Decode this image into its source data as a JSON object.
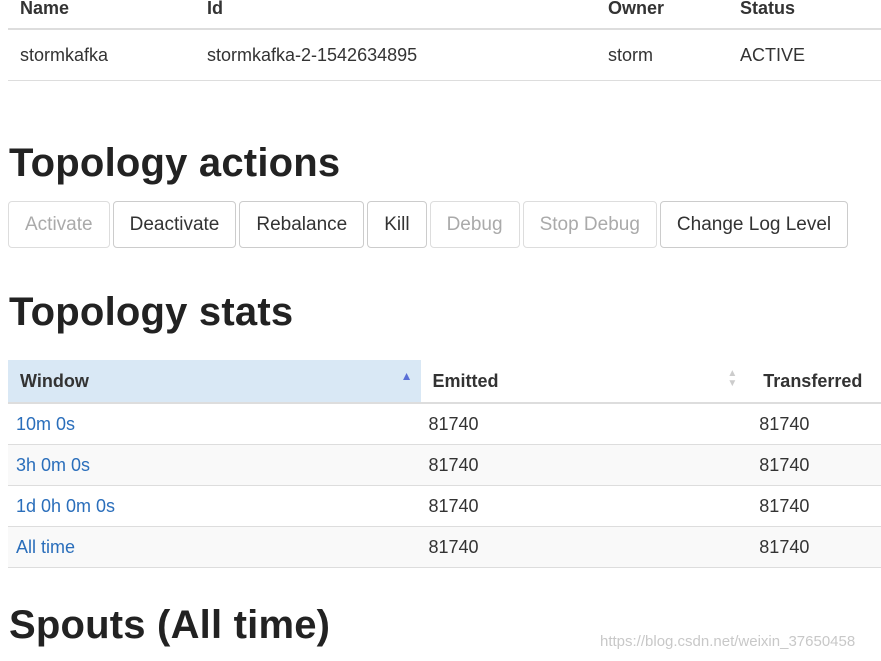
{
  "summary": {
    "headers": [
      "Name",
      "Id",
      "Owner",
      "Status"
    ],
    "row": [
      "stormkafka",
      "stormkafka-2-1542634895",
      "storm",
      "ACTIVE"
    ]
  },
  "actions": {
    "title": "Topology actions",
    "buttons": [
      {
        "label": "Activate",
        "enabled": false
      },
      {
        "label": "Deactivate",
        "enabled": true
      },
      {
        "label": "Rebalance",
        "enabled": true
      },
      {
        "label": "Kill",
        "enabled": true
      },
      {
        "label": "Debug",
        "enabled": false
      },
      {
        "label": "Stop Debug",
        "enabled": false
      },
      {
        "label": "Change Log Level",
        "enabled": true
      }
    ]
  },
  "stats": {
    "title": "Topology stats",
    "headers": [
      "Window",
      "Emitted",
      "Transferred"
    ],
    "rows": [
      {
        "window": "10m 0s",
        "emitted": "81740",
        "transferred": "81740"
      },
      {
        "window": "3h 0m 0s",
        "emitted": "81740",
        "transferred": "81740"
      },
      {
        "window": "1d 0h 0m 0s",
        "emitted": "81740",
        "transferred": "81740"
      },
      {
        "window": "All time",
        "emitted": "81740",
        "transferred": "81740"
      }
    ]
  },
  "spouts": {
    "title": "Spouts (All time)"
  },
  "watermark": "https://blog.csdn.net/weixin_37650458"
}
